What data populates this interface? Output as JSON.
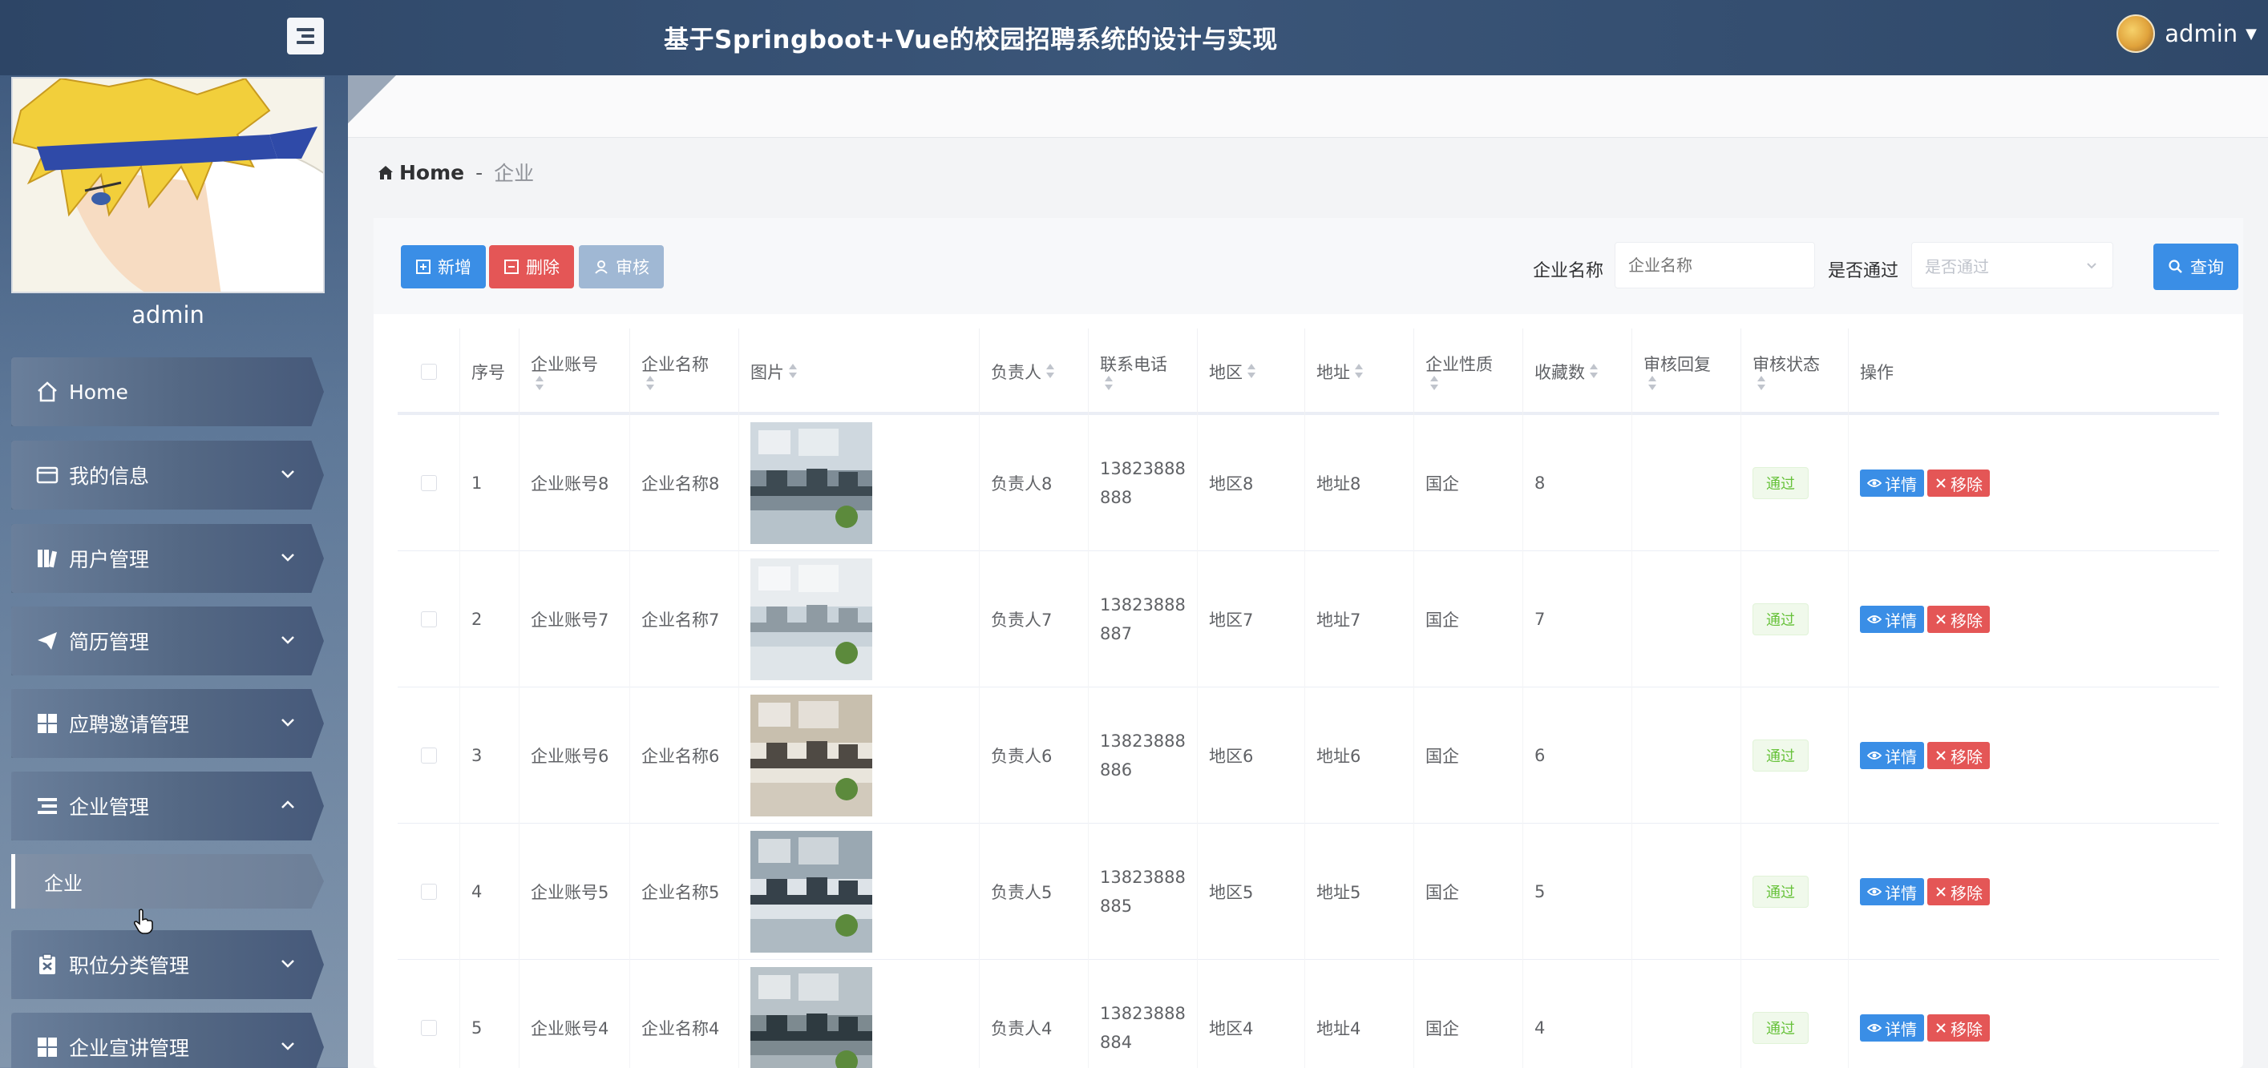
{
  "header": {
    "title": "基于Springboot+Vue的校园招聘系统的设计与实现",
    "username": "admin"
  },
  "sidebar": {
    "profile_name": "admin",
    "items": [
      {
        "label": "Home",
        "icon": "home-icon"
      },
      {
        "label": "我的信息",
        "icon": "id-card-icon"
      },
      {
        "label": "用户管理",
        "icon": "book-icon"
      },
      {
        "label": "简历管理",
        "icon": "paper-plane-icon"
      },
      {
        "label": "应聘邀请管理",
        "icon": "grid-icon"
      },
      {
        "label": "企业管理",
        "icon": "list-icon"
      },
      {
        "label": "职位分类管理",
        "icon": "clipboard-icon"
      },
      {
        "label": "企业宣讲管理",
        "icon": "grid-icon"
      }
    ],
    "sub_item": "企业"
  },
  "breadcrumb": {
    "home": "Home",
    "separator": "-",
    "current": "企业"
  },
  "toolbar": {
    "add_label": "新增",
    "delete_label": "删除",
    "audit_label": "审核",
    "search_label": "查询",
    "name_label": "企业名称",
    "name_placeholder": "企业名称",
    "pass_label": "是否通过",
    "pass_placeholder": "是否通过"
  },
  "table": {
    "headers": {
      "index": "序号",
      "account": "企业账号",
      "name": "企业名称",
      "image": "图片",
      "owner": "负责人",
      "phone": "联系电话",
      "region": "地区",
      "address": "地址",
      "nature": "企业性质",
      "favorites": "收藏数",
      "reply": "审核回复",
      "status": "审核状态",
      "actions": "操作"
    },
    "rows": [
      {
        "index": "1",
        "account": "企业账号8",
        "name": "企业名称8",
        "owner": "负责人8",
        "phone1": "13823888",
        "phone2": "888",
        "region": "地区8",
        "address": "地址8",
        "nature": "国企",
        "favorites": "8",
        "status": "通过"
      },
      {
        "index": "2",
        "account": "企业账号7",
        "name": "企业名称7",
        "owner": "负责人7",
        "phone1": "13823888",
        "phone2": "887",
        "region": "地区7",
        "address": "地址7",
        "nature": "国企",
        "favorites": "7",
        "status": "通过"
      },
      {
        "index": "3",
        "account": "企业账号6",
        "name": "企业名称6",
        "owner": "负责人6",
        "phone1": "13823888",
        "phone2": "886",
        "region": "地区6",
        "address": "地址6",
        "nature": "国企",
        "favorites": "6",
        "status": "通过"
      },
      {
        "index": "4",
        "account": "企业账号5",
        "name": "企业名称5",
        "owner": "负责人5",
        "phone1": "13823888",
        "phone2": "885",
        "region": "地区5",
        "address": "地址5",
        "nature": "国企",
        "favorites": "5",
        "status": "通过"
      },
      {
        "index": "5",
        "account": "企业账号4",
        "name": "企业名称4",
        "owner": "负责人4",
        "phone1": "13823888",
        "phone2": "884",
        "region": "地区4",
        "address": "地址4",
        "nature": "国企",
        "favorites": "4",
        "status": "通过"
      }
    ],
    "detail_label": "详情",
    "remove_label": "移除"
  }
}
